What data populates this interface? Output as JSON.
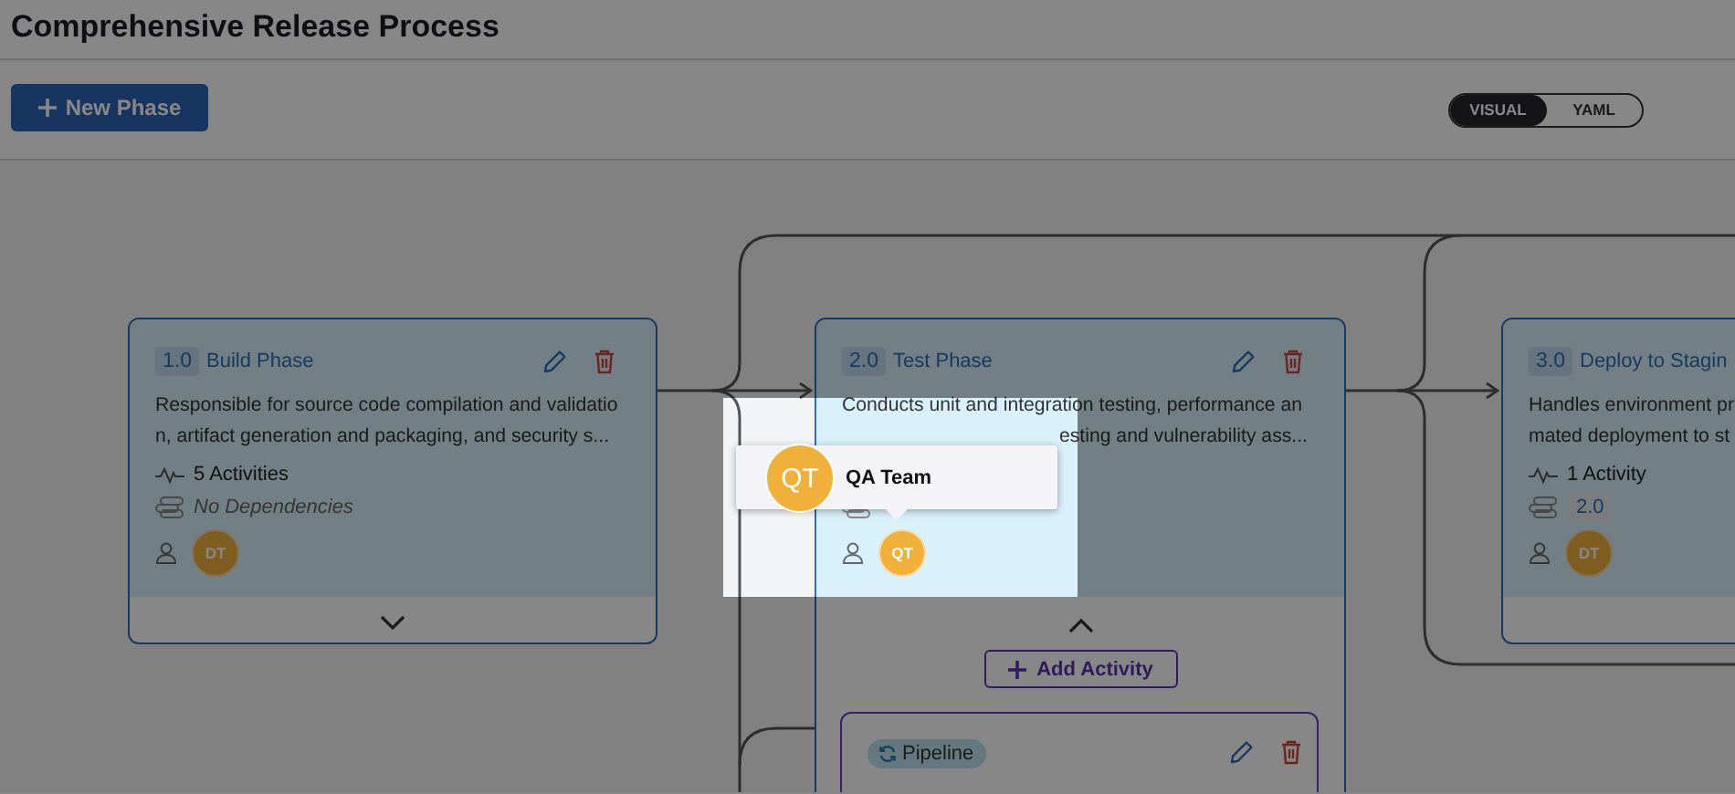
{
  "page": {
    "title": "Comprehensive Release Process"
  },
  "toolbar": {
    "new_phase_button": "New Phase",
    "view_toggle": [
      {
        "label": "VISUAL",
        "selected": true
      },
      {
        "label": "YAML",
        "selected": false
      }
    ]
  },
  "phases": [
    {
      "number": "1.0",
      "name": "Build Phase",
      "actions": true,
      "description": [
        {
          "kind": "full",
          "text": "Responsible for source code compilation and validatio"
        },
        {
          "kind": "full",
          "text": "n, artifact generation and packaging, and security s..."
        }
      ],
      "activities": "5 Activities",
      "dependencies": {
        "kind": "none",
        "text": "No Dependencies"
      },
      "owners": [
        {
          "initials": "DT"
        }
      ],
      "expanded": false
    },
    {
      "number": "2.0",
      "name": "Test Phase",
      "actions": true,
      "description": [
        {
          "kind": "full",
          "text": "Conducts unit and integration testing, performance an"
        },
        {
          "kind": "covered",
          "text": "esting and vulnerability ass..."
        }
      ],
      "dependencies": {
        "kind": "covered"
      },
      "owners": [
        {
          "initials": "QT"
        }
      ],
      "expanded": true,
      "add_activity_button": "Add Activity",
      "activities_list": [
        {
          "type": "Pipeline"
        }
      ]
    },
    {
      "number": "3.0",
      "name": "Deploy to Stagin",
      "description": [
        {
          "kind": "full",
          "text": "Handles environment pr"
        },
        {
          "kind": "full",
          "text": "mated deployment to st"
        }
      ],
      "activities": "1 Activity",
      "dependencies": {
        "kind": "chips",
        "chips": [
          "2.0"
        ]
      },
      "owners": [
        {
          "initials": "DT"
        }
      ]
    }
  ],
  "tooltip": {
    "initials": "QT",
    "name": "QA Team"
  }
}
